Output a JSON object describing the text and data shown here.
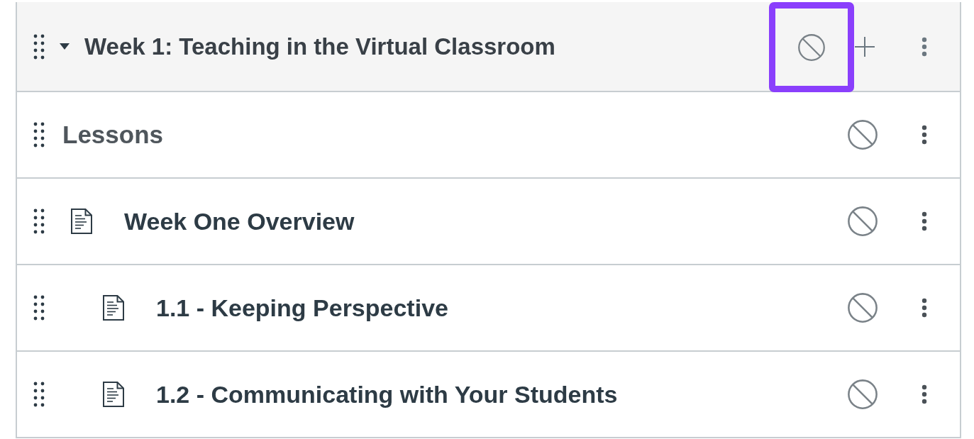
{
  "module": {
    "title": "Week 1: Teaching in the Virtual Classroom",
    "expanded": true,
    "published": false,
    "publish_highlighted": true,
    "items": [
      {
        "kind": "subheader",
        "title": "Lessons",
        "published": false,
        "children": [
          {
            "kind": "page",
            "title": "Week One Overview",
            "published": false,
            "children": [
              {
                "kind": "page",
                "title": "1.1 - Keeping Perspective",
                "published": false
              },
              {
                "kind": "page",
                "title": "1.2 - Communicating with Your Students",
                "published": false
              }
            ]
          }
        ]
      }
    ]
  }
}
